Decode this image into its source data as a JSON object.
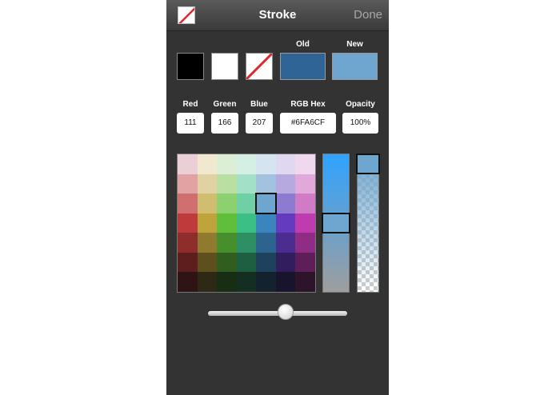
{
  "navbar": {
    "title": "Stroke",
    "done_label": "Done"
  },
  "swatches": {
    "old_label": "Old",
    "new_label": "New",
    "preset_colors": [
      "#000000",
      "#ffffff",
      "none"
    ],
    "old_color": "#2F6496",
    "new_color": "#6FA6CF"
  },
  "fields": {
    "red": {
      "label": "Red",
      "value": "111"
    },
    "green": {
      "label": "Green",
      "value": "166"
    },
    "blue": {
      "label": "Blue",
      "value": "207"
    },
    "hex": {
      "label": "RGB Hex",
      "value": "#6FA6CF"
    },
    "opacity": {
      "label": "Opacity",
      "value": "100%"
    }
  },
  "palette": {
    "selected": {
      "row": 2,
      "col": 4
    },
    "rows": [
      [
        "#eacfd6",
        "#f0e9d0",
        "#dcefd6",
        "#d6efe5",
        "#d6e4f0",
        "#e0d8f0",
        "#f0d8ee"
      ],
      [
        "#e0a2a2",
        "#e0d2a2",
        "#b9e0a2",
        "#a2e0c7",
        "#a2c2e0",
        "#b6a9e0",
        "#e0a9da"
      ],
      [
        "#d06f6f",
        "#d0bd6f",
        "#8cd06f",
        "#6fd0a6",
        "#6fa6cf",
        "#8c7bd0",
        "#d07bc5"
      ],
      [
        "#bf3b3b",
        "#bfa33b",
        "#5fbf3b",
        "#3bbf84",
        "#3b85bf",
        "#643bbf",
        "#bf3bb0"
      ],
      [
        "#8f2d2d",
        "#8f7a2d",
        "#478f2d",
        "#2d8f63",
        "#2d648f",
        "#4b2d8f",
        "#8f2d84"
      ],
      [
        "#5e1e1e",
        "#5e501e",
        "#2f5e1e",
        "#1e5e41",
        "#1e425e",
        "#311e5e",
        "#5e1e57"
      ],
      [
        "#2e1414",
        "#2e2914",
        "#182e14",
        "#142e22",
        "#14222e",
        "#19142e",
        "#2e142b"
      ]
    ]
  },
  "brightness_bar": {
    "top_color": "#2fa3ff",
    "bottom_color": "#9e9e9e",
    "value": 0.5
  },
  "opacity_bar": {
    "color": "#6FA6CF",
    "value": 1.0
  },
  "zoom_slider": {
    "value": 0.56
  }
}
